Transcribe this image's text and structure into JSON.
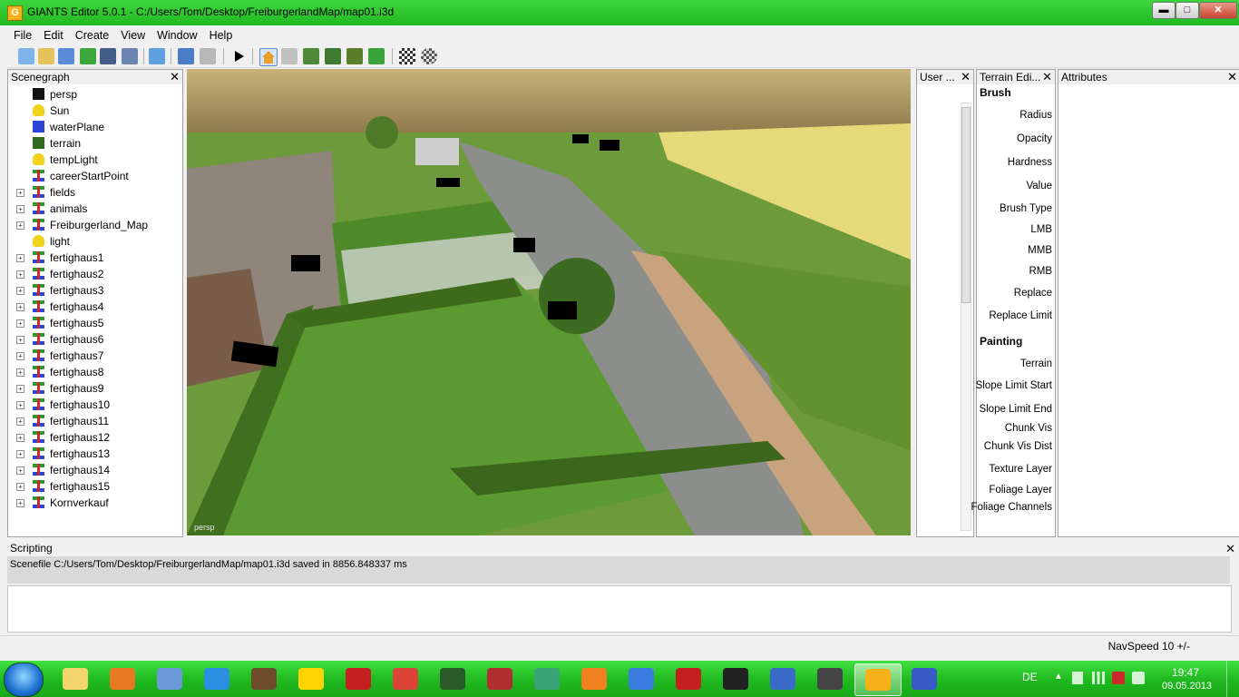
{
  "window": {
    "title": "GIANTS Editor 5.0.1 - C:/Users/Tom/Desktop/FreiburgerlandMap/map01.i3d",
    "app_icon_letter": "G",
    "controls": {
      "minimize": "▬",
      "maximize": "□",
      "close": "✕"
    }
  },
  "menu": [
    "File",
    "Edit",
    "Create",
    "View",
    "Window",
    "Help"
  ],
  "toolbar": [
    "new-icon",
    "open-icon",
    "list-icon",
    "refresh-icon",
    "save-icon",
    "save-as-icon",
    "import-icon",
    "undo-icon",
    "redo-icon",
    "play-icon",
    "home-icon",
    "magnet-icon",
    "terrain-raise-icon",
    "terrain-lower-icon",
    "terrain-paint-icon",
    "foliage-icon",
    "checker-icon",
    "checker-alt-icon"
  ],
  "scenegraph": {
    "title": "Scenegraph",
    "close": "✕",
    "items": [
      {
        "label": "persp",
        "icon": "camera-icon",
        "expandable": false
      },
      {
        "label": "Sun",
        "icon": "light-icon",
        "expandable": false
      },
      {
        "label": "waterPlane",
        "icon": "shape-icon",
        "expandable": false
      },
      {
        "label": "terrain",
        "icon": "terrain-icon",
        "expandable": false
      },
      {
        "label": "tempLight",
        "icon": "light-icon",
        "expandable": false
      },
      {
        "label": "careerStartPoint",
        "icon": "transform-group-icon",
        "expandable": false
      },
      {
        "label": "fields",
        "icon": "transform-group-icon",
        "expandable": true
      },
      {
        "label": "animals",
        "icon": "transform-group-icon",
        "expandable": true
      },
      {
        "label": "Freiburgerland_Map",
        "icon": "transform-group-icon",
        "expandable": true
      },
      {
        "label": "light",
        "icon": "light-icon",
        "expandable": false
      },
      {
        "label": "fertighaus1",
        "icon": "transform-group-icon",
        "expandable": true
      },
      {
        "label": "fertighaus2",
        "icon": "transform-group-icon",
        "expandable": true
      },
      {
        "label": "fertighaus3",
        "icon": "transform-group-icon",
        "expandable": true
      },
      {
        "label": "fertighaus4",
        "icon": "transform-group-icon",
        "expandable": true
      },
      {
        "label": "fertighaus5",
        "icon": "transform-group-icon",
        "expandable": true
      },
      {
        "label": "fertighaus6",
        "icon": "transform-group-icon",
        "expandable": true
      },
      {
        "label": "fertighaus7",
        "icon": "transform-group-icon",
        "expandable": true
      },
      {
        "label": "fertighaus8",
        "icon": "transform-group-icon",
        "expandable": true
      },
      {
        "label": "fertighaus9",
        "icon": "transform-group-icon",
        "expandable": true
      },
      {
        "label": "fertighaus10",
        "icon": "transform-group-icon",
        "expandable": true
      },
      {
        "label": "fertighaus11",
        "icon": "transform-group-icon",
        "expandable": true
      },
      {
        "label": "fertighaus12",
        "icon": "transform-group-icon",
        "expandable": true
      },
      {
        "label": "fertighaus13",
        "icon": "transform-group-icon",
        "expandable": true
      },
      {
        "label": "fertighaus14",
        "icon": "transform-group-icon",
        "expandable": true
      },
      {
        "label": "fertighaus15",
        "icon": "transform-group-icon",
        "expandable": true
      },
      {
        "label": "Kornverkauf",
        "icon": "transform-group-icon",
        "expandable": true
      }
    ]
  },
  "viewport": {
    "camera_label": "persp"
  },
  "user_panel": {
    "title": "User ...",
    "close": "✕"
  },
  "terrain_editor": {
    "title": "Terrain Edi...",
    "close": "✕",
    "brush_header": "Brush",
    "brush_fields": [
      "Radius",
      "Opacity",
      "Hardness",
      "Value",
      "Brush Type",
      "LMB",
      "MMB",
      "RMB",
      "Replace",
      "Replace Limit"
    ],
    "painting_header": "Painting",
    "painting_fields": [
      "Terrain",
      "Slope Limit Start",
      "Slope Limit End",
      "Chunk Vis",
      "Chunk Vis Dist",
      "Texture Layer",
      "Foliage Layer",
      "Foliage Channels"
    ]
  },
  "attributes": {
    "title": "Attributes",
    "close": "✕"
  },
  "scripting": {
    "title": "Scripting",
    "close": "✕",
    "output": "Scenefile C:/Users/Tom/Desktop/FreiburgerlandMap/map01.i3d saved in 8856.848337 ms"
  },
  "status": {
    "navspeed": "NavSpeed 10 +/-"
  },
  "taskbar": {
    "apps": [
      "explorer-icon",
      "media-player-icon",
      "settings-tool-icon",
      "internet-explorer-icon",
      "minecraft-icon",
      "mycomputer-icon",
      "football-manager-icon",
      "chrome-icon",
      "tractor-icon",
      "farming-simulator-icon",
      "stream-app-icon",
      "blender-icon",
      "rss-reader-icon",
      "farm-vehicle-icon",
      "origin-icon",
      "messenger-icon",
      "cursor-app-icon",
      "giants-editor-icon",
      "image-editor-icon"
    ],
    "active_index": 17,
    "language": "DE",
    "time": "19:47",
    "date": "09.05.2013"
  },
  "colors": {
    "accent_green": "#2ecb2e",
    "panel_bg": "#f0f0f0",
    "chrome_red": "#db4437"
  }
}
